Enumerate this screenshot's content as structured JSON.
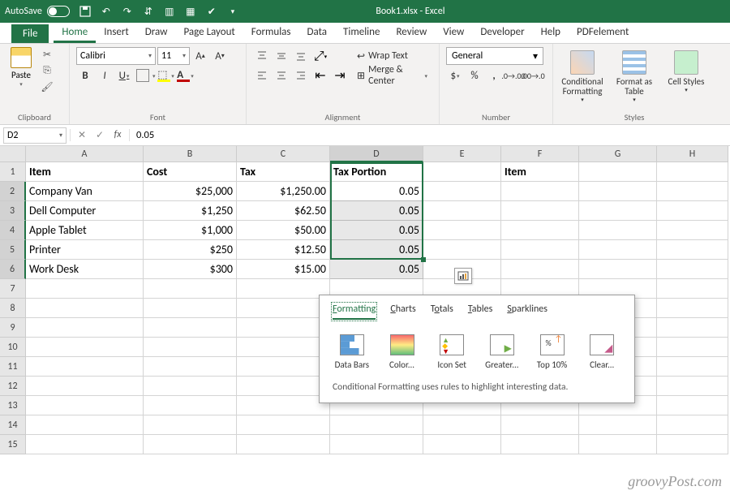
{
  "titlebar": {
    "autosave_label": "AutoSave",
    "autosave_state": "Off",
    "title": "Book1.xlsx - Excel"
  },
  "tabs": {
    "file": "File",
    "items": [
      "Home",
      "Insert",
      "Draw",
      "Page Layout",
      "Formulas",
      "Data",
      "Timeline",
      "Review",
      "View",
      "Developer",
      "Help",
      "PDFelement"
    ],
    "active": "Home"
  },
  "ribbon": {
    "clipboard": {
      "label": "Clipboard",
      "paste": "Paste"
    },
    "font": {
      "label": "Font",
      "name": "Calibri",
      "size": "11"
    },
    "alignment": {
      "label": "Alignment",
      "wrap": "Wrap Text",
      "merge": "Merge & Center"
    },
    "number": {
      "label": "Number",
      "format": "General"
    },
    "styles": {
      "label": "Styles",
      "cond": "Conditional Formatting",
      "table": "Format as Table",
      "cell": "Cell Styles"
    }
  },
  "formula_bar": {
    "namebox": "D2",
    "value": "0.05"
  },
  "grid": {
    "columns": [
      "A",
      "B",
      "C",
      "D",
      "E",
      "F",
      "G",
      "H"
    ],
    "selected_col": "D",
    "headers": {
      "A": "Item",
      "B": "Cost",
      "C": "Tax",
      "D": "Tax Portion",
      "F": "Item"
    },
    "rows": [
      {
        "A": "Company Van",
        "B": "$25,000",
        "C": "$1,250.00",
        "D": "0.05"
      },
      {
        "A": "Dell Computer",
        "B": "$1,250",
        "C": "$62.50",
        "D": "0.05"
      },
      {
        "A": "Apple Tablet",
        "B": "$1,000",
        "C": "$50.00",
        "D": "0.05"
      },
      {
        "A": "Printer",
        "B": "$250",
        "C": "$12.50",
        "D": "0.05"
      },
      {
        "A": "Work Desk",
        "B": "$300",
        "C": "$15.00",
        "D": "0.05"
      }
    ],
    "total_visible_rows": 15
  },
  "popup": {
    "tabs": [
      {
        "label": "Formatting",
        "ul": "F"
      },
      {
        "label": "Charts",
        "ul": "C"
      },
      {
        "label": "Totals",
        "ul": "o"
      },
      {
        "label": "Tables",
        "ul": "T"
      },
      {
        "label": "Sparklines",
        "ul": "S"
      }
    ],
    "active_tab": "Formatting",
    "items": [
      "Data Bars",
      "Color...",
      "Icon Set",
      "Greater...",
      "Top 10%",
      "Clear..."
    ],
    "footer": "Conditional Formatting uses rules to highlight interesting data."
  },
  "watermark": "groovyPost.com"
}
